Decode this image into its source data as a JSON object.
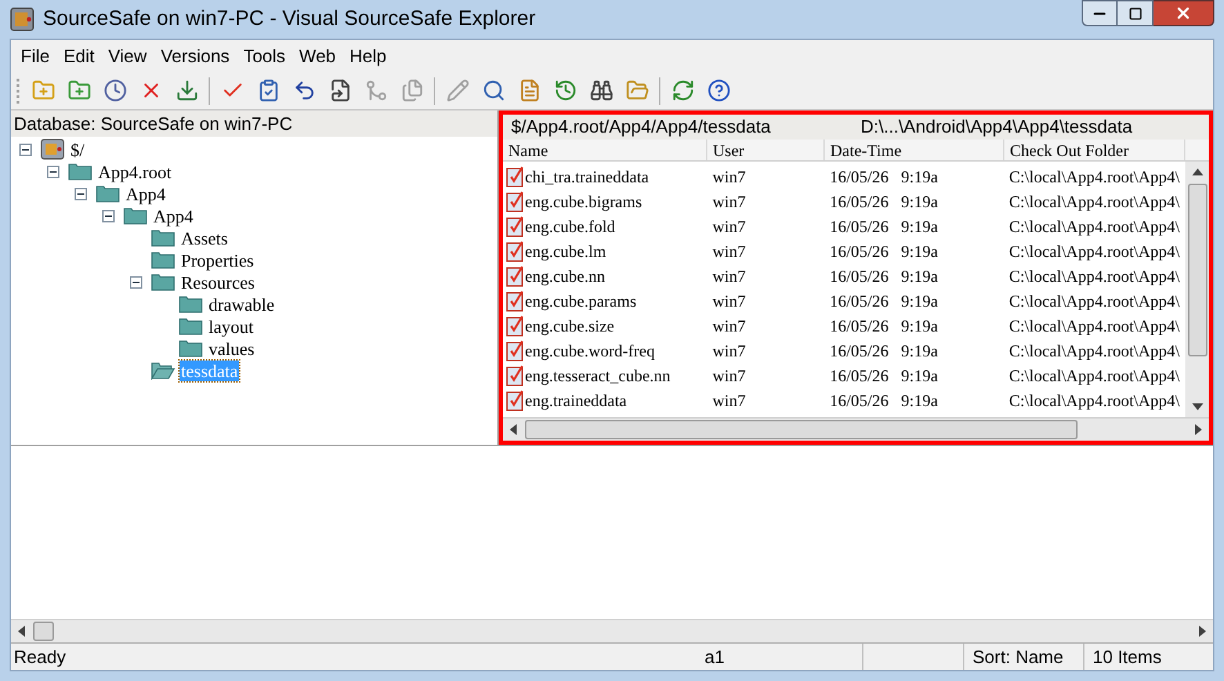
{
  "window": {
    "title": "SourceSafe on win7-PC - Visual SourceSafe Explorer"
  },
  "menu": [
    {
      "label": "File"
    },
    {
      "label": "Edit"
    },
    {
      "label": "View"
    },
    {
      "label": "Versions"
    },
    {
      "label": "Tools"
    },
    {
      "label": "Web"
    },
    {
      "label": "Help"
    }
  ],
  "left_pane": {
    "header": "Database: SourceSafe on win7-PC",
    "tree": [
      {
        "label": "$/",
        "kind": "database",
        "expanded": true,
        "selected": false,
        "children": [
          {
            "label": "App4.root",
            "kind": "folder",
            "expanded": true,
            "selected": false,
            "children": [
              {
                "label": "App4",
                "kind": "folder",
                "expanded": true,
                "selected": false,
                "children": [
                  {
                    "label": "App4",
                    "kind": "folder",
                    "expanded": true,
                    "selected": false,
                    "children": [
                      {
                        "label": "Assets",
                        "kind": "folder",
                        "selected": false
                      },
                      {
                        "label": "Properties",
                        "kind": "folder",
                        "selected": false
                      },
                      {
                        "label": "Resources",
                        "kind": "folder",
                        "expanded": true,
                        "selected": false,
                        "children": [
                          {
                            "label": "drawable",
                            "kind": "folder",
                            "selected": false
                          },
                          {
                            "label": "layout",
                            "kind": "folder",
                            "selected": false
                          },
                          {
                            "label": "values",
                            "kind": "folder",
                            "selected": false
                          }
                        ]
                      },
                      {
                        "label": "tessdata",
                        "kind": "folder",
                        "selected": true
                      }
                    ]
                  }
                ]
              }
            ]
          }
        ]
      }
    ]
  },
  "right_pane": {
    "project_path": "$/App4.root/App4/App4/tessdata",
    "working_folder": "D:\\...\\Android\\App4\\App4\\tessdata",
    "columns": [
      "Name",
      "User",
      "Date-Time",
      "Check Out Folder"
    ],
    "rows": [
      {
        "name": "chi_tra.traineddata",
        "user": "win7",
        "date_time": "16/05/26   9:19a",
        "check_out_folder": "C:\\local\\App4.root\\App4\\"
      },
      {
        "name": "eng.cube.bigrams",
        "user": "win7",
        "date_time": "16/05/26   9:19a",
        "check_out_folder": "C:\\local\\App4.root\\App4\\"
      },
      {
        "name": "eng.cube.fold",
        "user": "win7",
        "date_time": "16/05/26   9:19a",
        "check_out_folder": "C:\\local\\App4.root\\App4\\"
      },
      {
        "name": "eng.cube.lm",
        "user": "win7",
        "date_time": "16/05/26   9:19a",
        "check_out_folder": "C:\\local\\App4.root\\App4\\"
      },
      {
        "name": "eng.cube.nn",
        "user": "win7",
        "date_time": "16/05/26   9:19a",
        "check_out_folder": "C:\\local\\App4.root\\App4\\"
      },
      {
        "name": "eng.cube.params",
        "user": "win7",
        "date_time": "16/05/26   9:19a",
        "check_out_folder": "C:\\local\\App4.root\\App4\\"
      },
      {
        "name": "eng.cube.size",
        "user": "win7",
        "date_time": "16/05/26   9:19a",
        "check_out_folder": "C:\\local\\App4.root\\App4\\"
      },
      {
        "name": "eng.cube.word-freq",
        "user": "win7",
        "date_time": "16/05/26   9:19a",
        "check_out_folder": "C:\\local\\App4.root\\App4\\"
      },
      {
        "name": "eng.tesseract_cube.nn",
        "user": "win7",
        "date_time": "16/05/26   9:19a",
        "check_out_folder": "C:\\local\\App4.root\\App4\\"
      },
      {
        "name": "eng.traineddata",
        "user": "win7",
        "date_time": "16/05/26   9:19a",
        "check_out_folder": "C:\\local\\App4.root\\App4\\"
      }
    ]
  },
  "status_bar": {
    "message": "Ready",
    "user": "a1",
    "sort": "Sort: Name",
    "count": "10 Items"
  }
}
